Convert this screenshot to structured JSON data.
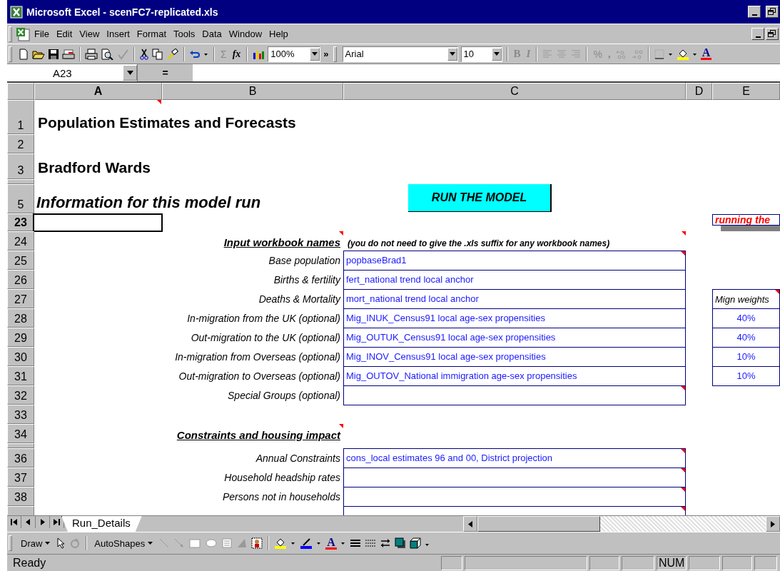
{
  "window": {
    "title": "Microsoft Excel - scenFC7-replicated.xls"
  },
  "menu": [
    {
      "label": "File"
    },
    {
      "label": "Edit"
    },
    {
      "label": "View"
    },
    {
      "label": "Insert"
    },
    {
      "label": "Format"
    },
    {
      "label": "Tools"
    },
    {
      "label": "Data"
    },
    {
      "label": "Window"
    },
    {
      "label": "Help"
    }
  ],
  "toolbar": {
    "sum": "Σ",
    "function": "fx",
    "zoom": "100%",
    "more": "»",
    "font": "Arial",
    "size": "10",
    "bold": "B",
    "italic": "I",
    "percent": "%",
    "comma": ",",
    "font_color": "A"
  },
  "formula_bar": {
    "name_box": "A23",
    "equals": "="
  },
  "columns": [
    {
      "label": "A",
      "selected": true
    },
    {
      "label": "B",
      "selected": false
    },
    {
      "label": "C",
      "selected": false
    },
    {
      "label": "D",
      "selected": false
    },
    {
      "label": "E",
      "selected": false
    }
  ],
  "rows": [
    {
      "number": "1",
      "kind": "title",
      "selected": false,
      "text": "Population Estimates and Forecasts",
      "comment": true
    },
    {
      "number": "2",
      "kind": "blank",
      "selected": false
    },
    {
      "number": "3",
      "kind": "title",
      "selected": false,
      "text": "Bradford Wards",
      "comment": false
    },
    {
      "kind": "collapsed",
      "selected": false
    },
    {
      "number": "5",
      "kind": "heading",
      "selected": false,
      "text": "Information for this model run",
      "button": "RUN THE MODEL"
    },
    {
      "number": "23",
      "kind": "blank",
      "selected": true,
      "note": "running the"
    },
    {
      "number": "24",
      "kind": "section",
      "selected": false,
      "label": "Input workbook names",
      "label_comment": true,
      "note": "(you do not need to give the .xls suffix for any workbook names)",
      "note_comment": true
    },
    {
      "number": "25",
      "kind": "input",
      "selected": false,
      "label": "Base population",
      "value": "popbaseBrad1",
      "value_comment": true
    },
    {
      "number": "26",
      "kind": "input",
      "selected": false,
      "label": "Births & fertility",
      "value": "fert_national trend local anchor",
      "value_comment": false
    },
    {
      "number": "27",
      "kind": "input",
      "selected": false,
      "label": "Deaths & Mortality",
      "value": "mort_national trend local anchor",
      "value_comment": false,
      "weight_header": "Mign weights",
      "weight_comment": true
    },
    {
      "number": "28",
      "kind": "input",
      "selected": false,
      "label": "In-migration from the UK (optional)",
      "value": "Mig_INUK_Census91 local age-sex propensities",
      "value_comment": false,
      "weight": "40%"
    },
    {
      "number": "29",
      "kind": "input",
      "selected": false,
      "label": "Out-migration to the UK (optional)",
      "value": "Mig_OUTUK_Census91 local age-sex propensities",
      "value_comment": false,
      "weight": "40%"
    },
    {
      "number": "30",
      "kind": "input",
      "selected": false,
      "label": "In-migration from Overseas (optional)",
      "value": "Mig_INOV_Census91 local age-sex propensities",
      "value_comment": false,
      "weight": "10%"
    },
    {
      "number": "31",
      "kind": "input",
      "selected": false,
      "label": "Out-migration to Overseas (optional)",
      "value": "Mig_OUTOV_National immigration age-sex propensities",
      "value_comment": false,
      "weight": "10%"
    },
    {
      "number": "32",
      "kind": "input",
      "selected": false,
      "label": "Special Groups (optional)",
      "value_comment": true
    },
    {
      "number": "33",
      "kind": "blank",
      "selected": false
    },
    {
      "number": "34",
      "kind": "section",
      "selected": false,
      "label": "Constraints and housing impact",
      "label_comment": true
    },
    {
      "kind": "collapsed",
      "selected": false
    },
    {
      "number": "36",
      "kind": "input",
      "selected": false,
      "label": "Annual Constraints",
      "value": "cons_local estimates 96 and 00, District projection",
      "value_comment": true
    },
    {
      "number": "37",
      "kind": "input",
      "selected": false,
      "label": "Household headship rates",
      "value_comment": true
    },
    {
      "number": "38",
      "kind": "input",
      "selected": false,
      "label": "Persons not in households",
      "value_comment": true
    },
    {
      "kind": "partial",
      "selected": false,
      "value_comment": true
    }
  ],
  "sheet_tabs": [
    {
      "label": "Run_Details",
      "selected": true
    }
  ],
  "draw_toolbar": {
    "draw": "Draw",
    "autoshapes": "AutoShapes",
    "font_color": "A"
  },
  "status_bar": {
    "text": "Ready",
    "num": "NUM"
  }
}
